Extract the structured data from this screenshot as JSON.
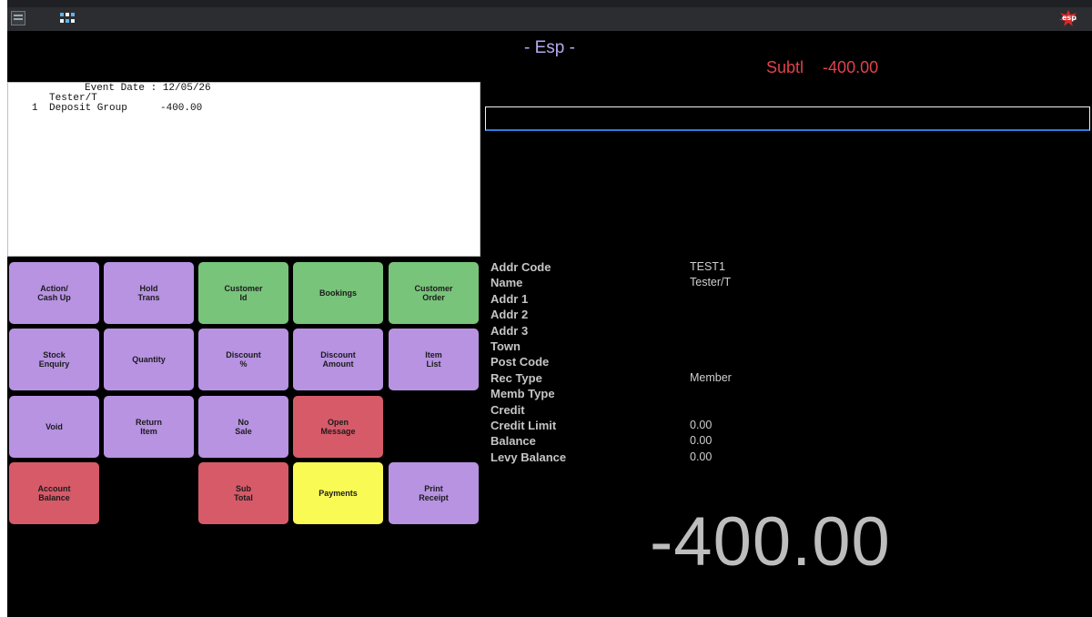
{
  "app": {
    "title": "- Esp -",
    "logo_text": "esp"
  },
  "subtotal": {
    "label": "Subtl",
    "value": "-400.00"
  },
  "receipt": {
    "event_line": "Event Date : 12/05/26",
    "customer_line": "Tester/T",
    "items": [
      {
        "qty": "1",
        "desc": "Deposit Group",
        "amount": "-400.00"
      }
    ]
  },
  "entry": {
    "value": ""
  },
  "buttons": [
    {
      "label": "Action/\nCash Up",
      "color": "purple"
    },
    {
      "label": "Hold\nTrans",
      "color": "purple"
    },
    {
      "label": "Customer\nId",
      "color": "green"
    },
    {
      "label": "Bookings",
      "color": "green"
    },
    {
      "label": "Customer\nOrder",
      "color": "green"
    },
    {
      "label": "Stock\nEnquiry",
      "color": "purple"
    },
    {
      "label": "Quantity",
      "color": "purple"
    },
    {
      "label": "Discount\n%",
      "color": "purple"
    },
    {
      "label": "Discount\nAmount",
      "color": "purple"
    },
    {
      "label": "Item\nList",
      "color": "purple"
    },
    {
      "label": "Void",
      "color": "purple"
    },
    {
      "label": "Return\nItem",
      "color": "purple"
    },
    {
      "label": "No\nSale",
      "color": "purple"
    },
    {
      "label": "Open\nMessage",
      "color": "red"
    },
    {
      "label": "Account\nBalance",
      "color": "red"
    },
    {
      "label": "Sub\nTotal",
      "color": "red"
    },
    {
      "label": "Payments",
      "color": "yellow"
    },
    {
      "label": "Print\nReceipt",
      "color": "purple"
    }
  ],
  "customer": [
    {
      "label": "Addr Code",
      "value": "TEST1"
    },
    {
      "label": "Name",
      "value": "Tester/T"
    },
    {
      "label": "Addr 1",
      "value": ""
    },
    {
      "label": "Addr 2",
      "value": ""
    },
    {
      "label": "Addr 3",
      "value": ""
    },
    {
      "label": "Town",
      "value": ""
    },
    {
      "label": "Post Code",
      "value": ""
    },
    {
      "label": "Rec Type",
      "value": "Member"
    },
    {
      "label": "Memb Type",
      "value": ""
    },
    {
      "label": "Credit",
      "value": ""
    },
    {
      "label": "Credit Limit",
      "value": "0.00"
    },
    {
      "label": "Balance",
      "value": "0.00"
    },
    {
      "label": "Levy Balance",
      "value": "0.00"
    }
  ],
  "total_display": "-400.00",
  "colors": {
    "purple": "#b793e2",
    "green": "#78c47a",
    "red": "#d75a69",
    "yellow": "#fafa55",
    "title": "#b7a8ee",
    "subtotal": "#e0424c"
  },
  "icons": [
    "window-menu-icon",
    "grid-apps-icon",
    "esp-logo-icon"
  ]
}
